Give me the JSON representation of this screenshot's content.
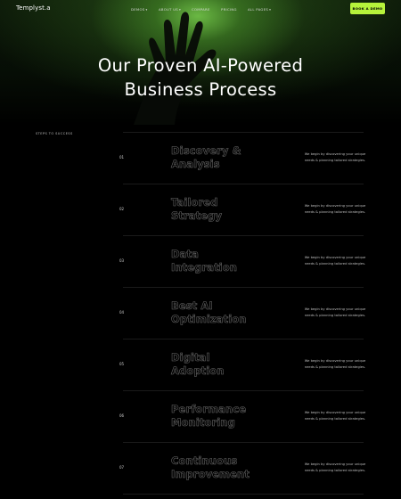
{
  "nav": {
    "logo": "Templyst.a",
    "items": [
      {
        "label": "DEMOS",
        "chevron": "chevron-down-icon"
      },
      {
        "label": "ABOUT US",
        "chevron": "chevron-down-icon"
      },
      {
        "label": "COMPARE",
        "chevron": ""
      },
      {
        "label": "PRICING",
        "chevron": ""
      },
      {
        "label": "ALL PAGES",
        "chevron": "chevron-down-icon"
      }
    ],
    "cta": "BOOK A DEMO"
  },
  "hero": {
    "title_line1": "Our Proven AI-Powered",
    "title_line2": "Business Process",
    "accent_color": "#b6f23b"
  },
  "steps": {
    "label": "STEPS TO SUCCESS",
    "items": [
      {
        "number": "01",
        "title_line1": "Discovery &",
        "title_line2": "Analysis",
        "desc_line1": "We begin by discovering your unique",
        "desc_line2": "needs & planning tailored strategies."
      },
      {
        "number": "02",
        "title_line1": "Tailored",
        "title_line2": "Strategy",
        "desc_line1": "We begin by discovering your unique",
        "desc_line2": "needs & planning tailored strategies."
      },
      {
        "number": "03",
        "title_line1": "Data",
        "title_line2": "Integration",
        "desc_line1": "We begin by discovering your unique",
        "desc_line2": "needs & planning tailored strategies."
      },
      {
        "number": "04",
        "title_line1": "Best AI",
        "title_line2": "Optimization",
        "desc_line1": "We begin by discovering your unique",
        "desc_line2": "needs & planning tailored strategies."
      },
      {
        "number": "05",
        "title_line1": "Digital",
        "title_line2": "Adoption",
        "desc_line1": "We begin by discovering your unique",
        "desc_line2": "needs & planning tailored strategies."
      },
      {
        "number": "06",
        "title_line1": "Performance",
        "title_line2": "Monitoring",
        "desc_line1": "We begin by discovering your unique",
        "desc_line2": "needs & planning tailored strategies."
      },
      {
        "number": "07",
        "title_line1": "Continuous",
        "title_line2": "Improvement",
        "desc_line1": "We begin by discovering your unique",
        "desc_line2": "needs & planning tailored strategies."
      }
    ]
  }
}
